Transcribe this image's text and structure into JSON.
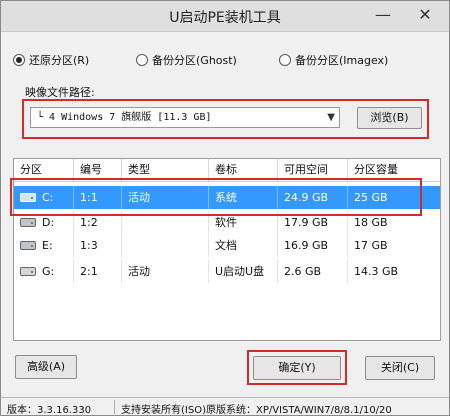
{
  "window": {
    "title": "U启动PE装机工具",
    "minimize_glyph": "—",
    "close_glyph": "✕"
  },
  "mode": {
    "options": [
      {
        "label": "还原分区(R)",
        "selected": true
      },
      {
        "label": "备份分区(Ghost)",
        "selected": false
      },
      {
        "label": "备份分区(Imagex)",
        "selected": false
      }
    ]
  },
  "image_path": {
    "label": "映像文件路径:",
    "value": "└ 4 Windows 7 旗舰版 [11.3 GB]",
    "browse_label": "浏览(B)"
  },
  "partitions": {
    "columns": [
      "分区",
      "编号",
      "类型",
      "卷标",
      "可用空间",
      "分区容量"
    ],
    "rows": [
      {
        "drive": "C:",
        "number": "1:1",
        "type": "活动",
        "label": "系统",
        "free": "24.9 GB",
        "size": "25 GB",
        "selected": true,
        "icon": "hard-drive-icon"
      },
      {
        "drive": "D:",
        "number": "1:2",
        "type": "",
        "label": "软件",
        "free": "17.9 GB",
        "size": "18 GB",
        "selected": false,
        "icon": "hard-drive-icon"
      },
      {
        "drive": "E:",
        "number": "1:3",
        "type": "",
        "label": "文档",
        "free": "16.9 GB",
        "size": "17 GB",
        "selected": false,
        "icon": "hard-drive-icon"
      },
      {
        "drive": "G:",
        "number": "2:1",
        "type": "活动",
        "label": "U启动U盘",
        "free": "2.6 GB",
        "size": "14.3 GB",
        "selected": false,
        "icon": "usb-drive-icon"
      }
    ]
  },
  "buttons": {
    "advanced": "高级(A)",
    "ok": "确定(Y)",
    "close": "关闭(C)"
  },
  "status": {
    "version": "版本：3.3.16.330",
    "support": "支持安装所有(ISO)原版系统：XP/VISTA/WIN7/8/8.1/10/20"
  },
  "colors": {
    "selection": "#3399ff",
    "highlight_box": "#d42a2a"
  }
}
